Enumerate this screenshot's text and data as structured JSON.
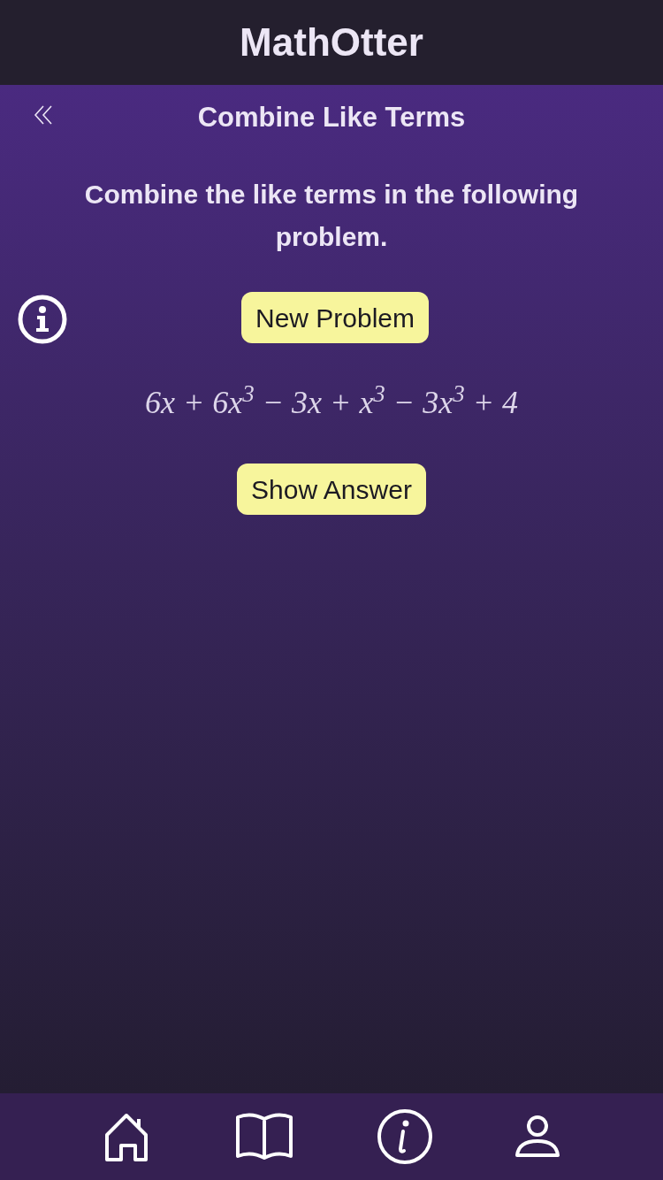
{
  "app_title": "MathOtter",
  "page": {
    "title": "Combine Like Terms"
  },
  "instructions": "Combine the like terms in the following problem.",
  "new_problem_button": "New Problem",
  "expression": "6x + 6x$^{3}$ − 3x + x$^{3}$ − 3x$^{3}$ + 4",
  "show_answer_button": "Show Answer"
}
